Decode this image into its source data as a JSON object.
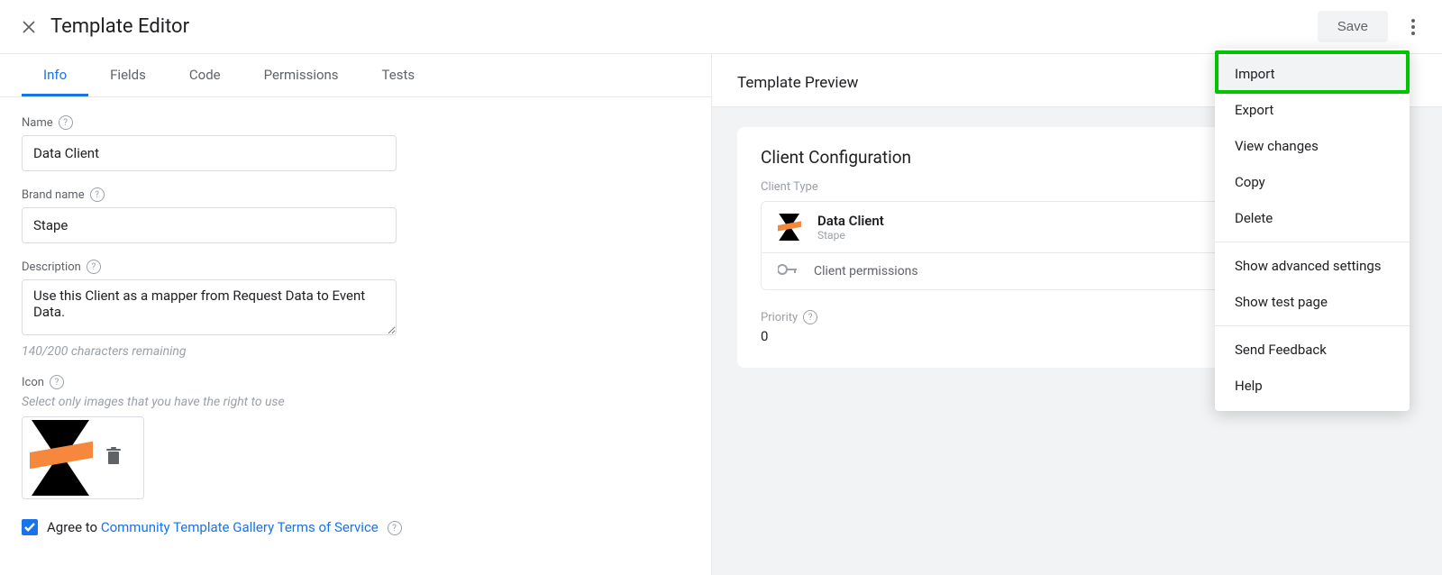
{
  "header": {
    "title": "Template Editor",
    "save_label": "Save"
  },
  "tabs": {
    "info": "Info",
    "fields": "Fields",
    "code": "Code",
    "permissions": "Permissions",
    "tests": "Tests"
  },
  "form": {
    "name_label": "Name",
    "name_value": "Data Client",
    "brand_label": "Brand name",
    "brand_value": "Stape",
    "description_label": "Description",
    "description_value": "Use this Client as a mapper from Request Data to Event Data.",
    "description_hint": "140/200 characters remaining",
    "icon_label": "Icon",
    "icon_hint": "Select only images that you have the right to use",
    "tos_prefix": "Agree to ",
    "tos_link": "Community Template Gallery Terms of Service"
  },
  "preview": {
    "header": "Template Preview",
    "card_title": "Client Configuration",
    "client_type_label": "Client Type",
    "client_name": "Data Client",
    "client_brand": "Stape",
    "client_permissions": "Client permissions",
    "priority_label": "Priority",
    "priority_value": "0"
  },
  "menu": {
    "import": "Import",
    "export": "Export",
    "view_changes": "View changes",
    "copy": "Copy",
    "delete": "Delete",
    "advanced": "Show advanced settings",
    "test_page": "Show test page",
    "feedback": "Send Feedback",
    "help": "Help"
  }
}
